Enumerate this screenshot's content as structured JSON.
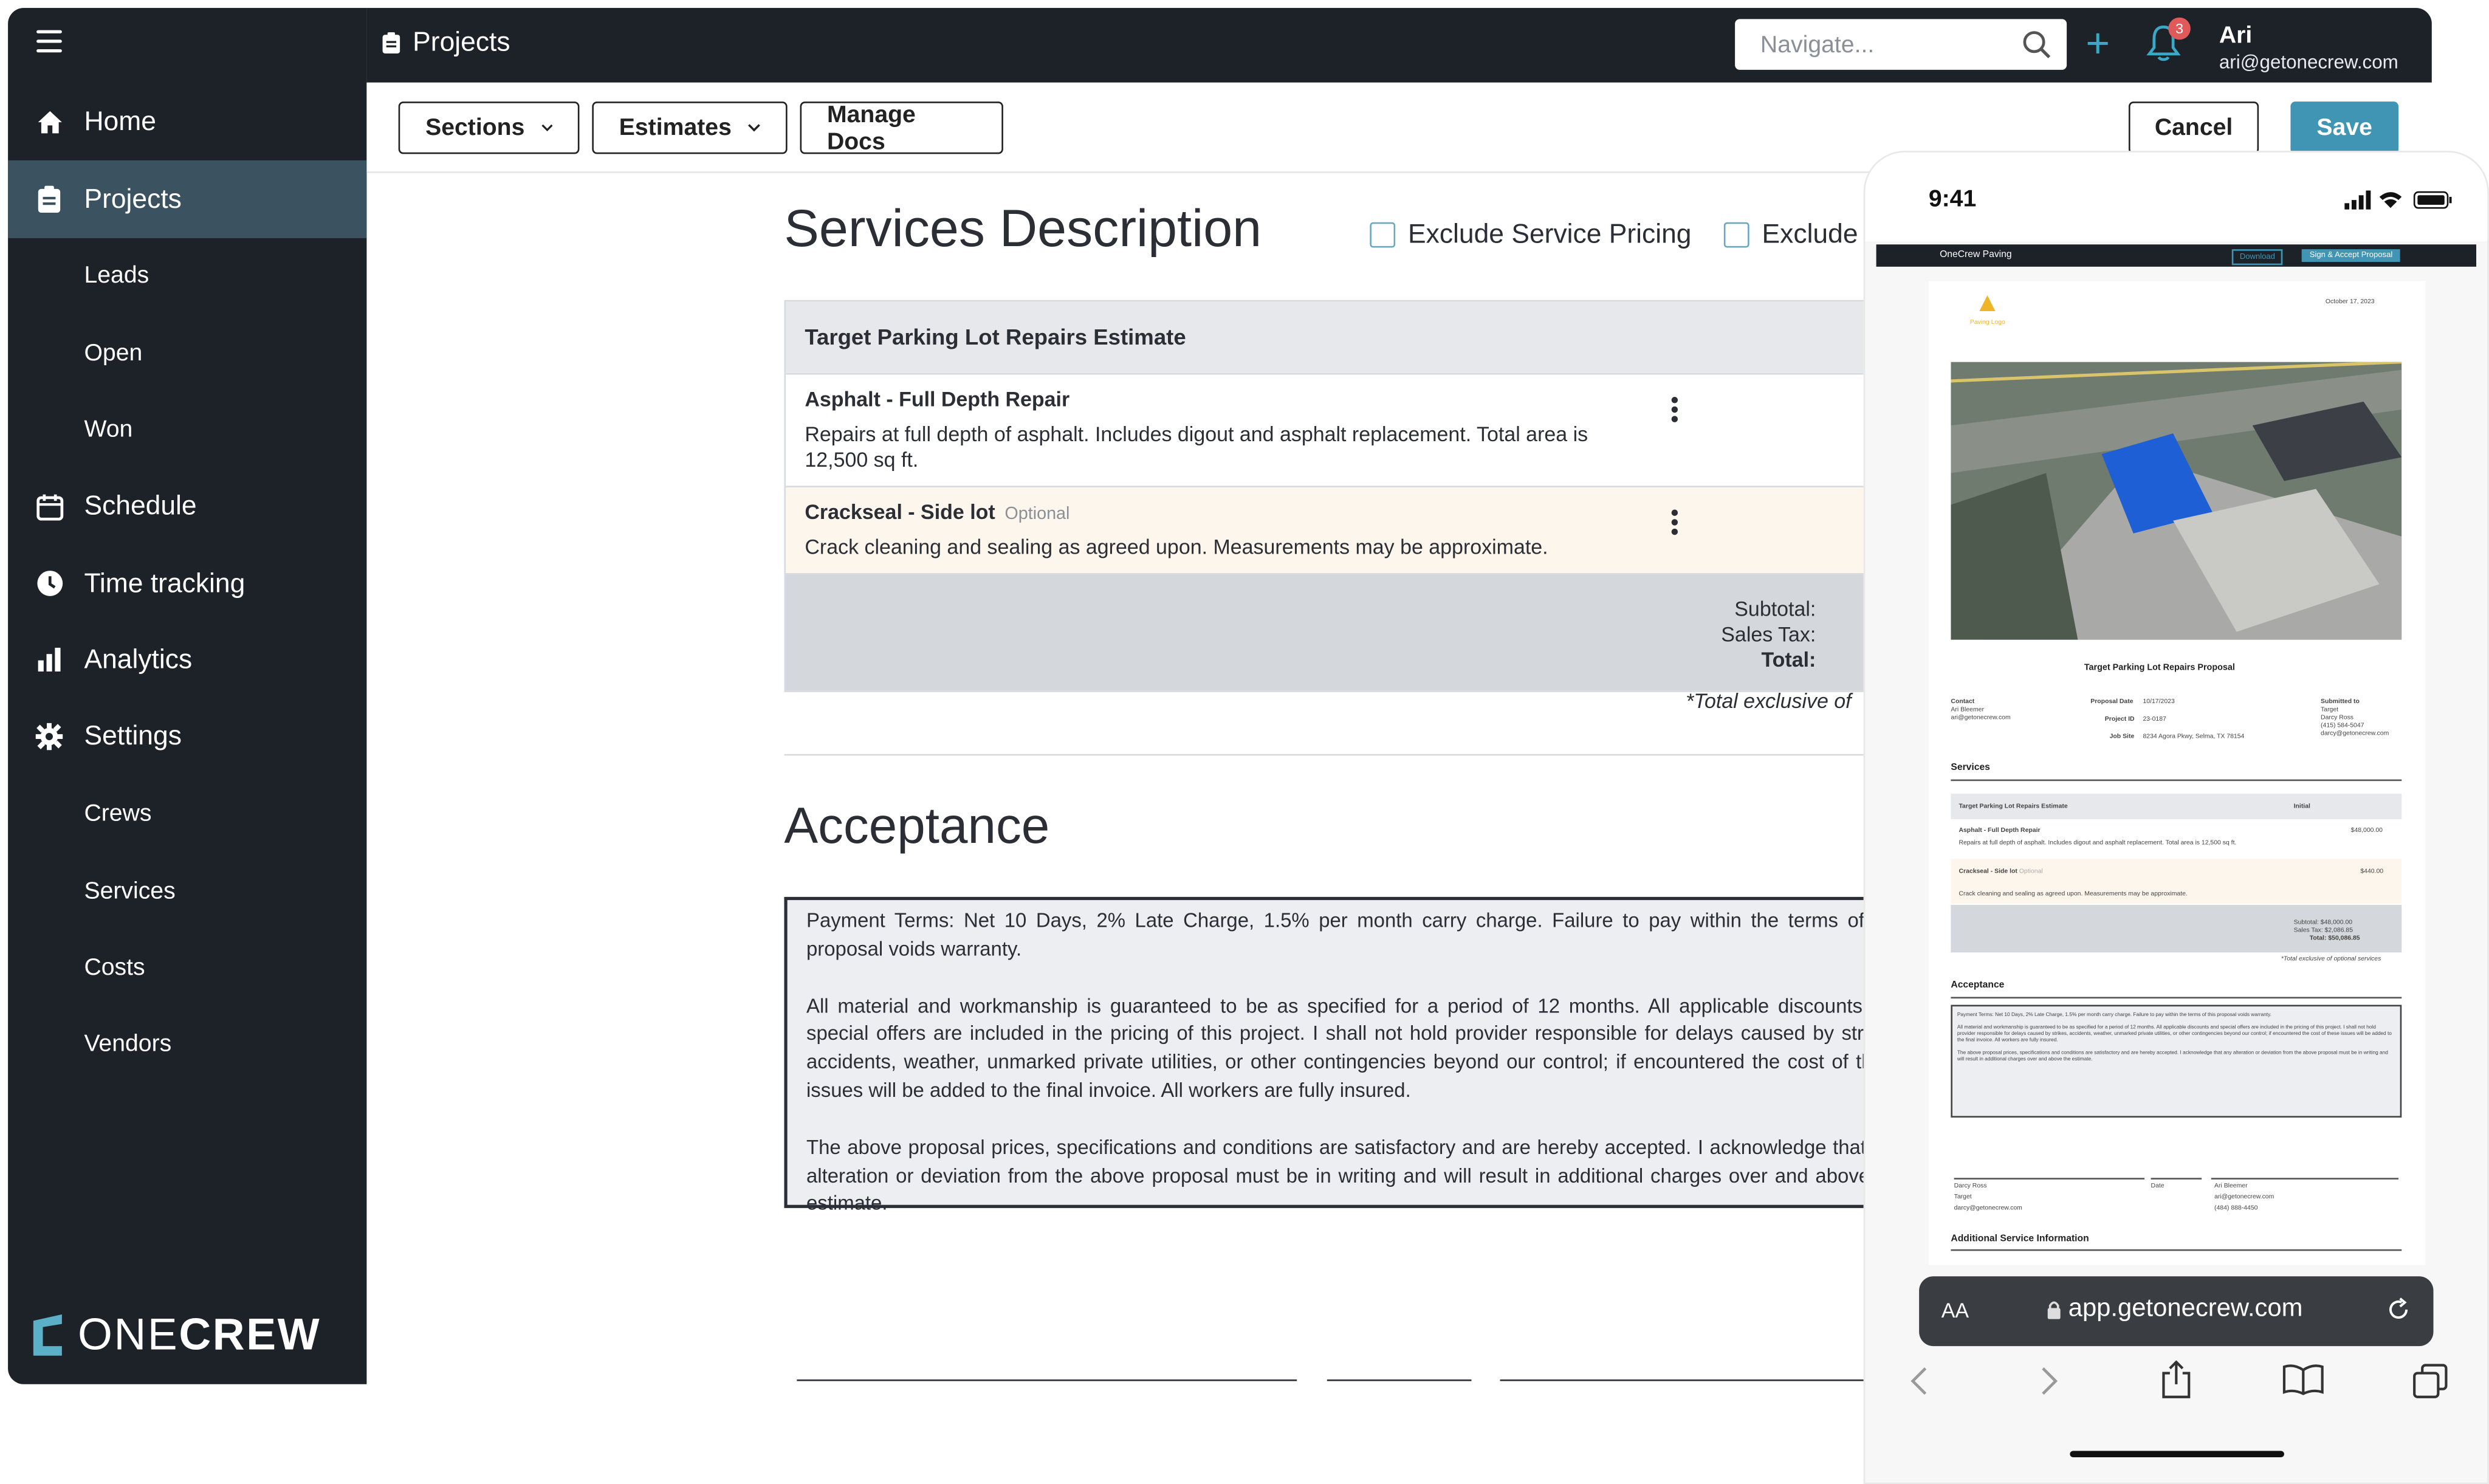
{
  "topbar": {
    "title": "Projects",
    "search_placeholder": "Navigate...",
    "notification_count": "3",
    "user_name": "Ari",
    "user_email": "ari@getonecrew.com"
  },
  "sidebar": {
    "items": [
      {
        "label": "Home",
        "icon": "home-icon"
      },
      {
        "label": "Projects",
        "icon": "clipboard-icon",
        "active": true
      },
      {
        "label": "Leads"
      },
      {
        "label": "Open"
      },
      {
        "label": "Won"
      },
      {
        "label": "Schedule",
        "icon": "calendar-icon"
      },
      {
        "label": "Time tracking",
        "icon": "clock-icon"
      },
      {
        "label": "Analytics",
        "icon": "bar-chart-icon"
      },
      {
        "label": "Settings",
        "icon": "gear-icon"
      },
      {
        "label": "Crews"
      },
      {
        "label": "Services"
      },
      {
        "label": "Costs"
      },
      {
        "label": "Vendors"
      }
    ],
    "logo_text_light": "ONE",
    "logo_text_bold": "CREW"
  },
  "toolbar": {
    "sections": "Sections",
    "estimates": "Estimates",
    "manage_docs": "Manage Docs",
    "cancel": "Cancel",
    "save": "Save"
  },
  "services": {
    "title": "Services Description",
    "exclude_pricing": "Exclude Service Pricing",
    "exclude_other": "Exclude",
    "table_title": "Target Parking Lot Repairs Estimate",
    "rows": [
      {
        "name": "Asphalt - Full Depth Repair",
        "desc": "Repairs at full depth of asphalt. Includes digout and asphalt replacement. Total area is 12,500 sq ft.",
        "optional": ""
      },
      {
        "name": "Crackseal - Side lot",
        "desc": "Crack cleaning and sealing as agreed upon. Measurements may be approximate.",
        "optional": "Optional"
      }
    ],
    "subtotal_label": "Subtotal:",
    "tax_label": "Sales Tax:",
    "total_label": "Total:",
    "exclusive_note": "*Total exclusive of"
  },
  "acceptance": {
    "title": "Acceptance",
    "p1": "Payment Terms: Net 10 Days, 2% Late Charge, 1.5% per month carry charge. Failure to pay within the terms of this proposal voids warranty.",
    "p2": "All material and workmanship is guaranteed to be as specified for a period of 12 months. All applicable discounts and special offers are included in the pricing of this project. I shall not hold provider responsible for delays caused by strikes, accidents, weather, unmarked private utilities, or other contingencies beyond our control; if encountered the cost of these issues will be added to the final invoice. All workers are fully insured.",
    "p3": "The above proposal prices, specifications and conditions are satisfactory and are hereby accepted. I acknowledge that any alteration or deviation from the above proposal must be in writing and will result in additional charges over and above the estimate."
  },
  "phone": {
    "time": "9:41",
    "company": "OneCrew Paving",
    "download": "Download",
    "sign": "Sign & Accept Proposal",
    "date": "October 17, 2023",
    "logo_label": "Paving Logo",
    "proposal_title": "Target Parking Lot Repairs Proposal",
    "contact_label": "Contact",
    "contact_name": "Ari Bleemer",
    "contact_email": "ari@getonecrew.com",
    "proposal_date_label": "Proposal Date",
    "proposal_date": "10/17/2023",
    "project_id_label": "Project ID",
    "project_id": "23-0187",
    "job_site_label": "Job Site",
    "job_site": "8234 Agora Pkwy, Selma, TX 78154",
    "submitted_label": "Submitted to",
    "submitted_to": "Target",
    "submitted_name": "Darcy Ross",
    "submitted_phone": "(415) 584-5047",
    "submitted_email": "darcy@getonecrew.com",
    "services_heading": "Services",
    "mini_table_title": "Target Parking Lot Repairs Estimate",
    "mini_initial": "Initial",
    "mini_row1": "Asphalt - Full Depth Repair",
    "mini_row1_price": "$48,000.00",
    "mini_row1_desc": "Repairs at full depth of asphalt. Includes digout and asphalt replacement. Total area is 12,500 sq ft.",
    "mini_row2": "Crackseal - Side lot",
    "mini_row2_opt": "Optional",
    "mini_row2_price": "$440.00",
    "mini_row2_desc": "Crack cleaning and sealing as agreed upon. Measurements may be approximate.",
    "mini_subtotal": "Subtotal: $48,000.00",
    "mini_tax": "Sales Tax: $2,086.85",
    "mini_total": "Total: $50,086.85",
    "mini_excl": "*Total exclusive of optional services",
    "acceptance_heading": "Acceptance",
    "sig1_name": "Darcy Ross",
    "sig1_company": "Target",
    "sig1_email": "darcy@getonecrew.com",
    "sig_date": "Date",
    "sig2_name": "Ari Bleemer",
    "sig2_email": "ari@getonecrew.com",
    "sig2_phone": "(484) 888-4450",
    "additional_heading": "Additional Service Information",
    "text_size": "AA",
    "url": "app.getonecrew.com"
  },
  "colors": {
    "sidebar_bg": "#1d2128",
    "active_bg": "#3b5361",
    "accent": "#3f95b3",
    "optional_row": "#fdf6ec"
  }
}
